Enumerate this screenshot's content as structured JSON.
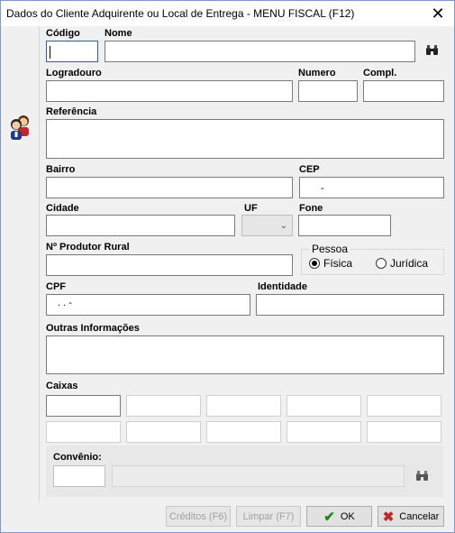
{
  "window": {
    "title": "Dados do Cliente Adquirente ou Local de Entrega - MENU FISCAL (F12)",
    "close": "✕"
  },
  "labels": {
    "codigo": "Código",
    "nome": "Nome",
    "logradouro": "Logradouro",
    "numero": "Numero",
    "compl": "Compl.",
    "referencia": "Referência",
    "bairro": "Bairro",
    "cep": "CEP",
    "cidade": "Cidade",
    "uf": "UF",
    "fone": "Fone",
    "produtor": "Nº Produtor Rural",
    "cpf": "CPF",
    "identidade": "Identidade",
    "outras": "Outras Informações",
    "caixas": "Caixas",
    "convenio": "Convênio:"
  },
  "values": {
    "cep": "-",
    "cpf": ". .  -"
  },
  "pessoa": {
    "title": "Pessoa",
    "options": [
      "Física",
      "Jurídica"
    ],
    "selected": "Física"
  },
  "buttons": {
    "creditos": "Créditos (F6)",
    "limpar": "Limpar (F7)",
    "ok": "OK",
    "cancelar": "Cancelar"
  },
  "colors": {
    "ok_icon": "#1a8a1a",
    "cancel_icon": "#c0282d"
  }
}
